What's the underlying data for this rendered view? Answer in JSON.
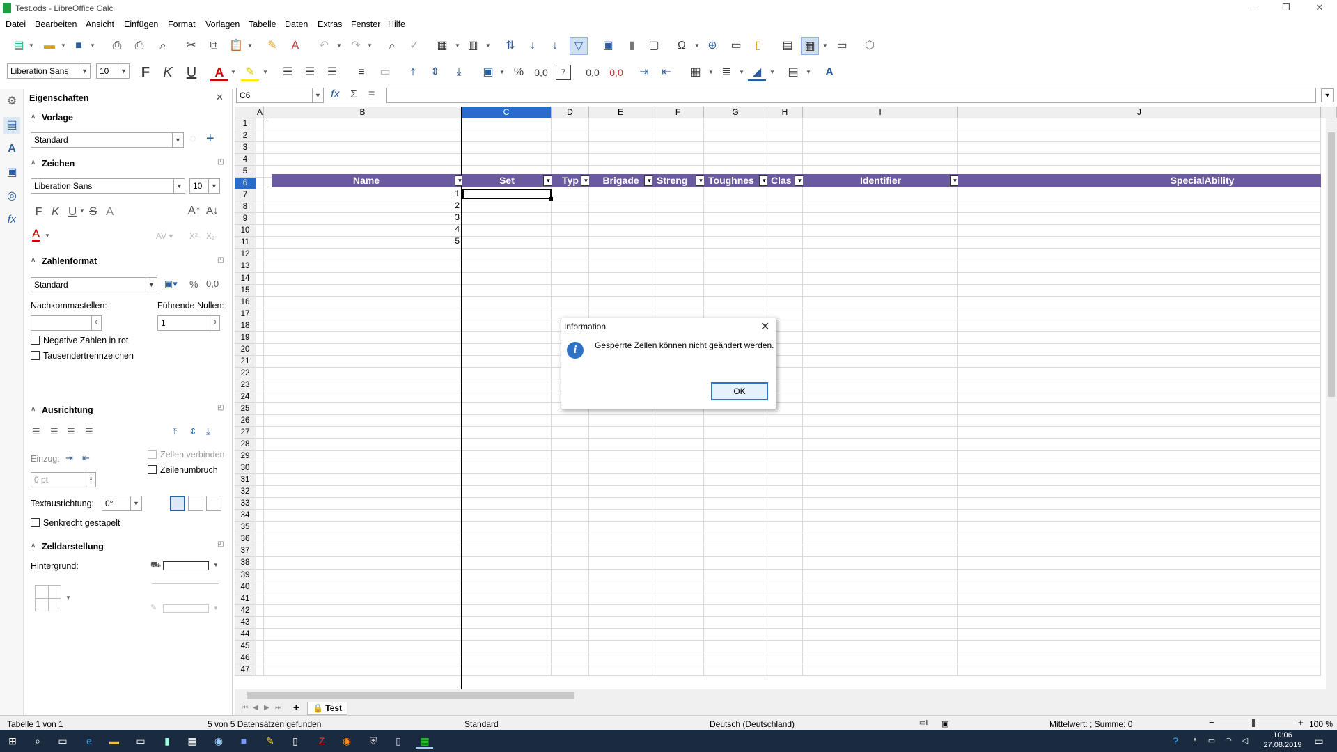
{
  "window": {
    "title": "Test.ods - LibreOffice Calc"
  },
  "menu": [
    "Datei",
    "Bearbeiten",
    "Ansicht",
    "Einfügen",
    "Format",
    "Vorlagen",
    "Tabelle",
    "Daten",
    "Extras",
    "Fenster",
    "Hilfe"
  ],
  "format_toolbar": {
    "font_name": "Liberation Sans",
    "font_size": "10",
    "bold": "F",
    "italic": "K",
    "underline": "U"
  },
  "formula_bar": {
    "name_box": "C6",
    "value": ""
  },
  "sidebar": {
    "title": "Eigenschaften",
    "vorlage": {
      "title": "Vorlage",
      "style": "Standard"
    },
    "zeichen": {
      "title": "Zeichen",
      "font": "Liberation Sans",
      "size": "10"
    },
    "zahlenformat": {
      "title": "Zahlenformat",
      "format": "Standard",
      "nachkommastellen_label": "Nachkommastellen:",
      "nachkommastellen_value": "",
      "fuehrende_label": "Führende Nullen:",
      "fuehrende_value": "1",
      "neg_rot": "Negative Zahlen in rot",
      "tausender": "Tausendertrennzeichen"
    },
    "ausrichtung": {
      "title": "Ausrichtung",
      "einzug_label": "Einzug:",
      "einzug_value": "0 pt",
      "zellen_verbinden": "Zellen verbinden",
      "zeilenumbruch": "Zeilenumbruch",
      "textausrichtung_label": "Textausrichtung:",
      "textausrichtung_value": "0°",
      "senkrecht": "Senkrecht gestapelt"
    },
    "zelldarstellung": {
      "title": "Zelldarstellung",
      "hintergrund_label": "Hintergrund:"
    }
  },
  "sheet": {
    "columns": [
      "A",
      "B",
      "C",
      "D",
      "E",
      "F",
      "G",
      "H",
      "I",
      "J"
    ],
    "selected_column": "C",
    "selected_row": "6",
    "table_headers": [
      "Name",
      "Set",
      "Typ",
      "Brigade",
      "Streng",
      "Toughnes",
      "Clas",
      "Identifier",
      "SpecialAbility"
    ],
    "b_values": [
      "1",
      "2",
      "3",
      "4",
      "5"
    ],
    "row_count": 47,
    "dot_mark": "·"
  },
  "dialog": {
    "title": "Information",
    "message": "Gesperrte Zellen können nicht geändert werden.",
    "ok": "OK"
  },
  "sheet_tabs": {
    "tab": "Test"
  },
  "statusbar": {
    "sheet": "Tabelle 1 von 1",
    "found": "5 von 5 Datensätzen gefunden",
    "style": "Standard",
    "language": "Deutsch (Deutschland)",
    "summary": "Mittelwert: ; Summe: 0",
    "zoom": "100 %"
  },
  "taskbar": {
    "time": "10:06",
    "date": "27.08.2019"
  },
  "colors": {
    "header_bg": "#6b5b9e",
    "selection": "#2a6ccc"
  }
}
